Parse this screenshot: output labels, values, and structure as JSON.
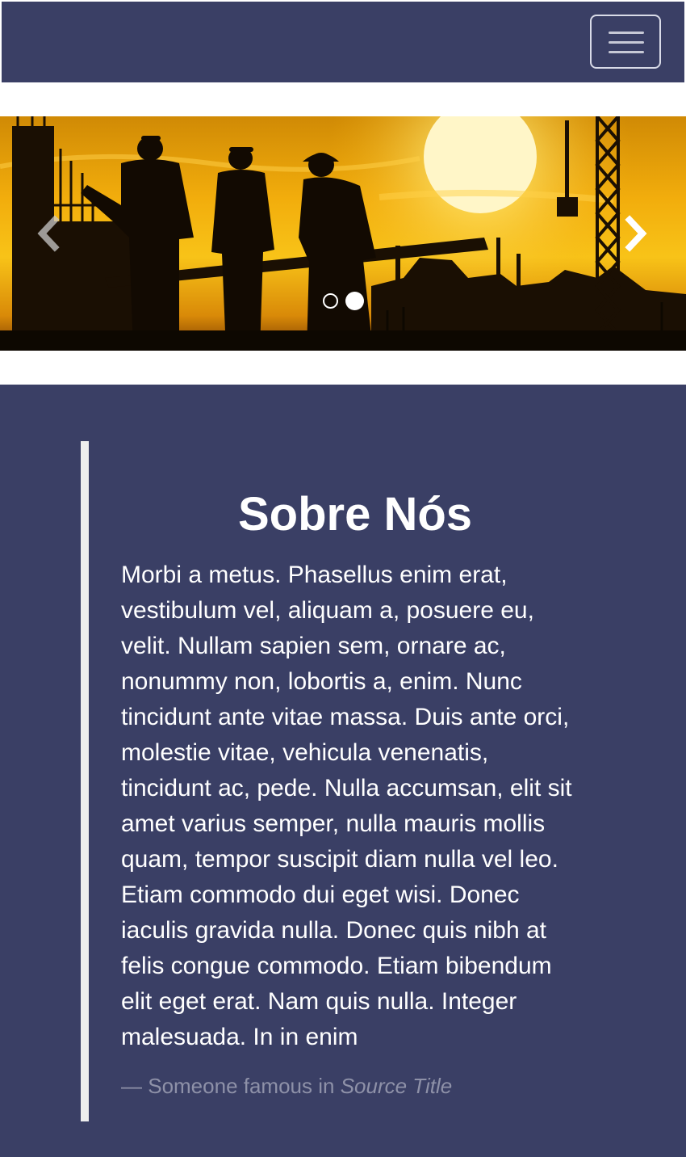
{
  "navbar": {
    "toggle_icon": "hamburger-menu-icon",
    "background": "#3a3f65"
  },
  "carousel": {
    "slide_count": 2,
    "active_slide": 2,
    "prev_icon": "chevron-left-icon",
    "next_icon": "chevron-right-icon"
  },
  "about": {
    "title": "Sobre Nós",
    "text": "Morbi a metus. Phasellus enim erat, vestibulum vel, aliquam a, posuere eu, velit. Nullam sapien sem, ornare ac, nonummy non, lobortis a, enim. Nunc tincidunt ante vitae massa. Duis ante orci, molestie vitae, vehicula venenatis, tincidunt ac, pede. Nulla accumsan, elit sit amet varius semper, nulla mauris mollis quam, tempor suscipit diam nulla vel leo. Etiam commodo dui eget wisi. Donec iaculis gravida nulla. Donec quis nibh at felis congue commodo. Etiam bibendum elit eget erat. Nam quis nulla. Integer malesuada. In in enim",
    "footer_prefix": "— Someone famous in",
    "footer_source": "Source Title",
    "background": "#3a3f65"
  }
}
